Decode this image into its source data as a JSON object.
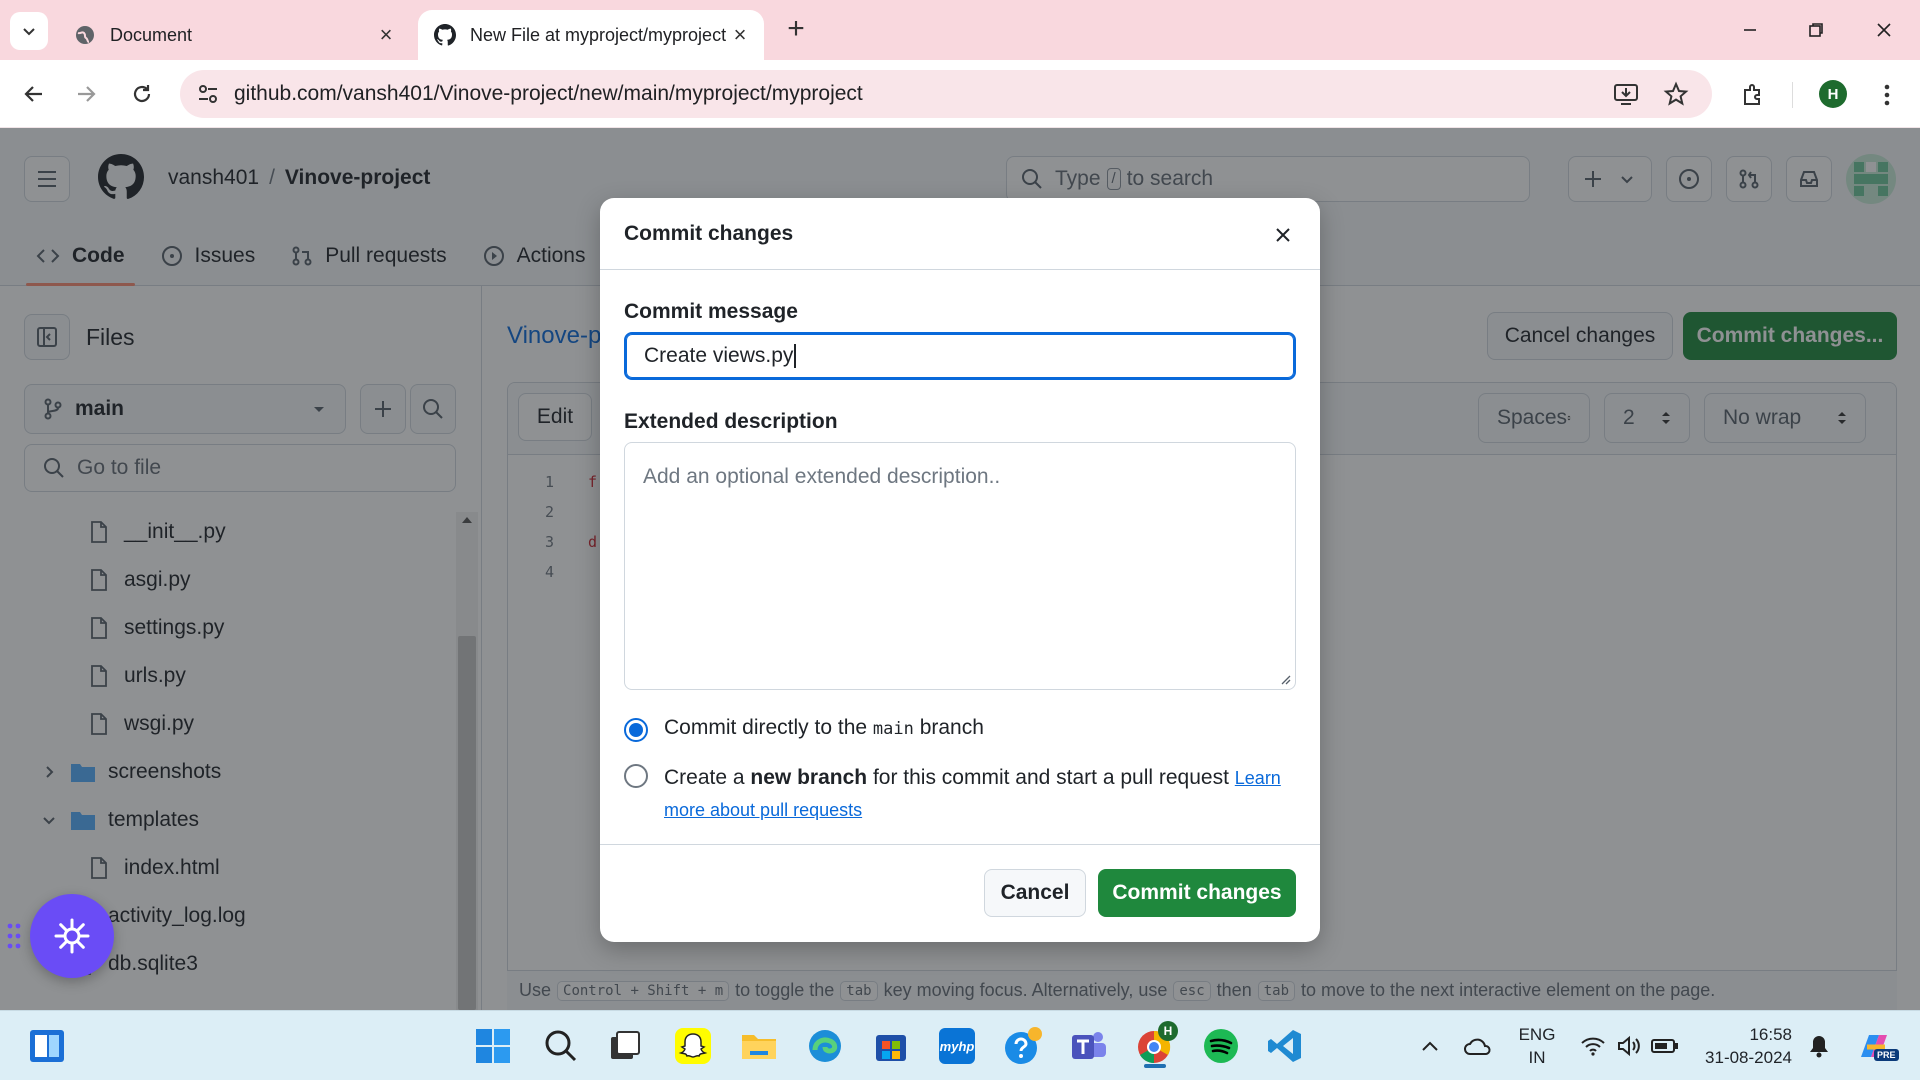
{
  "browser": {
    "tabs": [
      {
        "title": "Document",
        "active": false,
        "icon": "globe-icon"
      },
      {
        "title": "New File at myproject/myproject",
        "active": true,
        "icon": "github-icon"
      }
    ],
    "url": "github.com/vansh401/Vinove-project/new/main/myproject/myproject",
    "profile_initial": "H"
  },
  "repo": {
    "owner": "vansh401",
    "separator": "/",
    "name": "Vinove-project",
    "search_placeholder_pre": "Type",
    "search_key": "/",
    "search_placeholder_post": "to search",
    "nav": [
      "Code",
      "Issues",
      "Pull requests",
      "Actions"
    ]
  },
  "sidebar": {
    "title": "Files",
    "branch": "main",
    "goto_placeholder": "Go to file",
    "tree": [
      {
        "name": "__init__.py",
        "type": "file",
        "indent": 2
      },
      {
        "name": "asgi.py",
        "type": "file",
        "indent": 2
      },
      {
        "name": "settings.py",
        "type": "file",
        "indent": 2
      },
      {
        "name": "urls.py",
        "type": "file",
        "indent": 2
      },
      {
        "name": "wsgi.py",
        "type": "file",
        "indent": 2
      },
      {
        "name": "screenshots",
        "type": "folder",
        "expanded": false,
        "indent": 1
      },
      {
        "name": "templates",
        "type": "folder",
        "expanded": true,
        "indent": 1
      },
      {
        "name": "index.html",
        "type": "file",
        "indent": 2
      },
      {
        "name": "activity_log.log",
        "type": "file",
        "indent": 1
      },
      {
        "name": "db.sqlite3",
        "type": "file",
        "indent": 1
      }
    ]
  },
  "editor": {
    "file_title": "Vinove-p",
    "cancel_label": "Cancel changes",
    "commit_label": "Commit changes...",
    "edit_tab": "Edit",
    "indent_mode": "Spaces",
    "indent_size": "2",
    "wrap_mode": "No wrap",
    "line_numbers": [
      "1",
      "2",
      "3",
      "4"
    ],
    "code_fragments": [
      "f",
      "d"
    ],
    "hint": {
      "p1": "Use",
      "k1": "Control + Shift + m",
      "p2": "to toggle the",
      "k2": "tab",
      "p3": "key moving focus. Alternatively, use",
      "k3": "esc",
      "p4": "then",
      "k4": "tab",
      "p5": "to move to the next interactive element on the page."
    }
  },
  "modal": {
    "title": "Commit changes",
    "message_label": "Commit message",
    "message_value": "Create views.py",
    "description_label": "Extended description",
    "description_placeholder": "Add an optional extended description..",
    "option_direct_pre": "Commit directly to the",
    "option_direct_branch": "main",
    "option_direct_post": "branch",
    "option_new_pre": "Create a",
    "option_new_bold": "new branch",
    "option_new_post": "for this commit and start a pull request",
    "learn_more_1": "Learn",
    "learn_more_2": "more about pull requests",
    "selected_option": "direct",
    "cancel_label": "Cancel",
    "commit_label": "Commit changes"
  },
  "taskbar": {
    "apps": [
      "start-icon",
      "search-icon",
      "task-view-icon",
      "snapchat-icon",
      "file-explorer-icon",
      "edge-icon",
      "microsoft-store-icon",
      "myhp-icon",
      "help-icon",
      "teams-icon",
      "chrome-icon",
      "spotify-icon",
      "vscode-icon"
    ],
    "myhp_label": "myhp",
    "chrome_badge": "H",
    "lang_line1": "ENG",
    "lang_line2": "IN",
    "time": "16:58",
    "date": "31-08-2024",
    "copilot_badge": "PRE"
  },
  "colors": {
    "accent": "#0969da",
    "primary_button": "#1f883d",
    "tabstrip": "#f9d8de",
    "fab": "#6a4cf6",
    "taskbar": "#dceef6"
  }
}
